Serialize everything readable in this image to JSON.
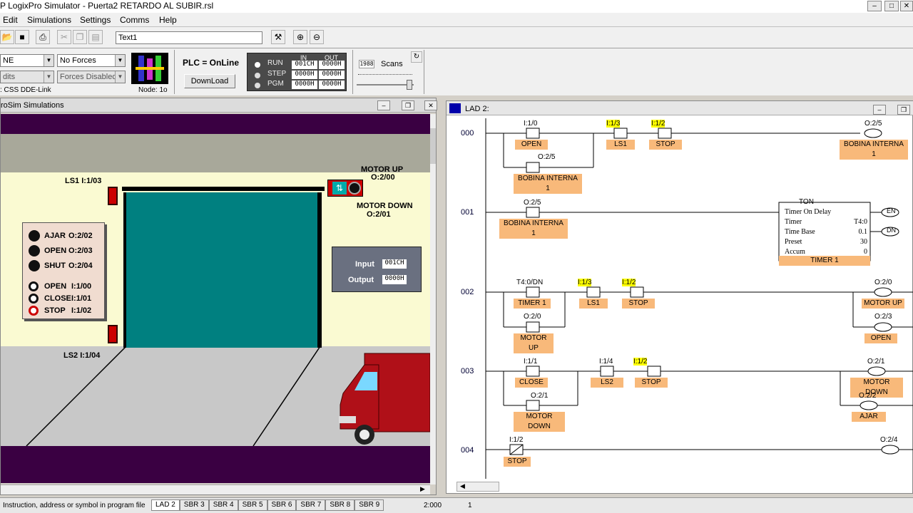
{
  "app": {
    "title": "P LogixPro Simulator - Puerta2 RETARDO AL SUBIR.rsl",
    "win_min": "–",
    "win_max": "□",
    "win_close": "✕"
  },
  "menu": [
    "Edit",
    "Simulations",
    "Settings",
    "Comms",
    "Help"
  ],
  "toolbar": {
    "text_field": "Text1"
  },
  "controls": {
    "mode_select": "NE",
    "forces_select": "No Forces",
    "edits_select": "dits",
    "forces_enabled_select": "Forces Disabled",
    "link_label": ": CSS DDE-Link",
    "node_label": "Node: 1o",
    "plc_status": "PLC = OnLine",
    "download_btn": "DownLoad",
    "run_label": "RUN",
    "step_label": "STEP",
    "pgm_label": "PGM",
    "in_header": "IN",
    "out_header": "OUT",
    "in_values": [
      "001CH",
      "0000H",
      "0000H"
    ],
    "out_values": [
      "0000H",
      "0000H",
      "0000H"
    ],
    "scans_count": "1988",
    "scans_label": "Scans"
  },
  "sim": {
    "title": "roSim Simulations",
    "ls1": "LS1   I:1/03",
    "ls2": "LS2   I:1/04",
    "motor_up": "MOTOR UP",
    "motor_up_addr": "O:2/00",
    "motor_down": "MOTOR DOWN",
    "motor_down_addr": "O:2/01",
    "panel": [
      {
        "label": "AJAR",
        "addr": "O:2/02"
      },
      {
        "label": "OPEN",
        "addr": "O:2/03"
      },
      {
        "label": "SHUT",
        "addr": "O:2/04"
      }
    ],
    "switches": [
      {
        "label": "OPEN",
        "addr": "I:1/00"
      },
      {
        "label": "CLOSE",
        "addr": "I:1/01"
      },
      {
        "label": "STOP",
        "addr": "I:1/02"
      }
    ],
    "io_input_label": "Input",
    "io_input_val": "001CH",
    "io_output_label": "Output",
    "io_output_val": "0000H"
  },
  "lad": {
    "title": "LAD 2:",
    "rungs": [
      "000",
      "001",
      "002",
      "003",
      "004"
    ],
    "timer": {
      "type": "TON",
      "title": "Timer On Delay",
      "timer_label": "Timer",
      "timer_val": "T4:0",
      "tb_label": "Time Base",
      "tb_val": "0.1",
      "preset_label": "Preset",
      "preset_val": "30",
      "accum_label": "Accum",
      "accum_val": "0",
      "en": "EN",
      "dn": "DN",
      "symbol": "TIMER 1"
    },
    "r0": {
      "c1a": "I:1/0",
      "c1s": "OPEN",
      "c2a": "O:2/5",
      "c2s": "BOBINA INTERNA 1",
      "c3a": "I:1/3",
      "c3s": "LS1",
      "c4a": "I:1/2",
      "c4s": "STOP",
      "coa": "O:2/5",
      "cos": "BOBINA INTERNA 1"
    },
    "r1": {
      "c1a": "O:2/5",
      "c1s": "BOBINA INTERNA 1"
    },
    "r2": {
      "c1a": "T4:0/DN",
      "c1s": "TIMER 1",
      "c2a": "O:2/0",
      "c2s": "MOTOR UP",
      "c3a": "I:1/3",
      "c3s": "LS1",
      "c4a": "I:1/2",
      "c4s": "STOP",
      "o1a": "O:2/0",
      "o1s": "MOTOR UP",
      "o2a": "O:2/3",
      "o2s": "OPEN"
    },
    "r3": {
      "c1a": "I:1/1",
      "c1s": "CLOSE",
      "c2a": "O:2/1",
      "c2s": "MOTOR DOWN",
      "c3a": "I:1/4",
      "c3s": "LS2",
      "c4a": "I:1/2",
      "c4s": "STOP",
      "o1a": "O:2/1",
      "o1s": "MOTOR DOWN",
      "o2a": "O:2/2",
      "o2s": "AJAR"
    },
    "r4": {
      "c1a": "I:1/2",
      "c1s": "STOP",
      "o1a": "O:2/4"
    }
  },
  "status": {
    "hint": "Instruction, address or symbol in program file",
    "tabs": [
      "LAD 2",
      "SBR 3",
      "SBR 4",
      "SBR 5",
      "SBR 6",
      "SBR 7",
      "SBR 8",
      "SBR 9"
    ],
    "pos": "2:000",
    "num": "1"
  },
  "colors": {
    "highlight": "#ffff00",
    "symbol_bg": "#f8b97a",
    "door": "#008080",
    "sim_band": "#3a0042",
    "truck": "#b01018"
  }
}
